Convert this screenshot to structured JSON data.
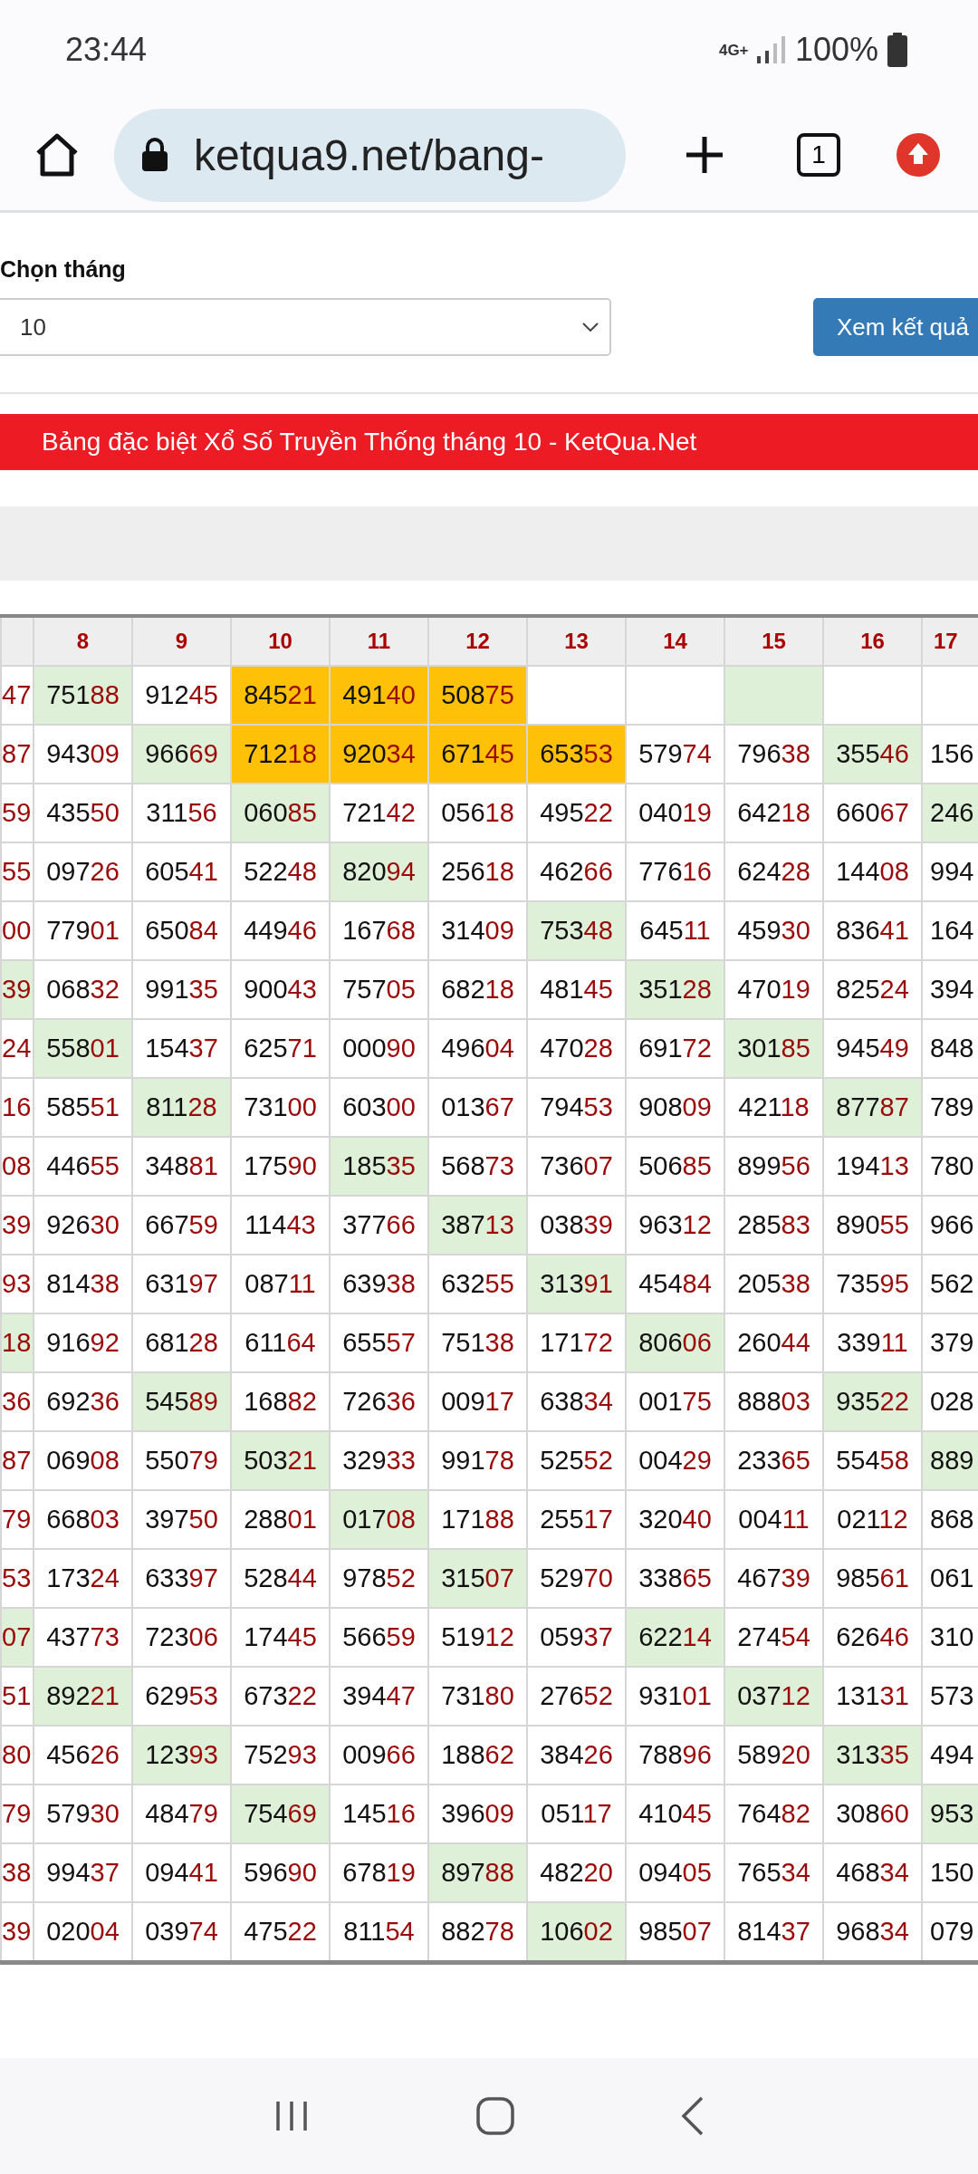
{
  "status_bar": {
    "time": "23:44",
    "network": "4G+",
    "battery": "100%"
  },
  "browser": {
    "url": "ketqua9.net/bang-",
    "tab_count": "1"
  },
  "form": {
    "label": "Chọn tháng",
    "month_select": {
      "value": "10"
    },
    "submit_button": "Xem kết quả"
  },
  "banner": "Bảng đặc biệt Xổ Số Truyền Thống tháng 10 - KetQua.Net",
  "table": {
    "columns": [
      "",
      "8",
      "9",
      "10",
      "11",
      "12",
      "13",
      "14",
      "15",
      "16",
      "17"
    ],
    "rows": [
      {
        "cells": [
          {
            "tail": "47",
            "color": "#ffffff"
          },
          {
            "head": "751",
            "tail": "88",
            "color": "#dff0d8"
          },
          {
            "head": "912",
            "tail": "45",
            "color": "#ffffff"
          },
          {
            "head": "845",
            "tail": "21",
            "color": "#ffc107"
          },
          {
            "head": "491",
            "tail": "40",
            "color": "#ffc107"
          },
          {
            "head": "508",
            "tail": "75",
            "color": "#ffc107"
          },
          {
            "color": "#ffffff"
          },
          {
            "color": "#ffffff"
          },
          {
            "color": "#dff0d8"
          },
          {
            "color": "#ffffff"
          },
          {
            "color": "#ffffff"
          }
        ]
      },
      {
        "cells": [
          {
            "tail": "87",
            "color": "#ffffff"
          },
          {
            "head": "943",
            "tail": "09",
            "color": "#ffffff"
          },
          {
            "head": "966",
            "tail": "69",
            "color": "#dff0d8"
          },
          {
            "head": "712",
            "tail": "18",
            "color": "#ffc107"
          },
          {
            "head": "920",
            "tail": "34",
            "color": "#ffc107"
          },
          {
            "head": "671",
            "tail": "45",
            "color": "#ffc107"
          },
          {
            "head": "653",
            "tail": "53",
            "color": "#ffc107"
          },
          {
            "head": "579",
            "tail": "74",
            "color": "#ffffff"
          },
          {
            "head": "796",
            "tail": "38",
            "color": "#ffffff"
          },
          {
            "head": "355",
            "tail": "46",
            "color": "#dff0d8"
          },
          {
            "head": "156",
            "color": "#ffffff"
          }
        ]
      },
      {
        "cells": [
          {
            "tail": "59",
            "color": "#ffffff"
          },
          {
            "head": "435",
            "tail": "50",
            "color": "#ffffff"
          },
          {
            "head": "311",
            "tail": "56",
            "color": "#ffffff"
          },
          {
            "head": "060",
            "tail": "85",
            "color": "#dff0d8"
          },
          {
            "head": "721",
            "tail": "42",
            "color": "#ffffff"
          },
          {
            "head": "056",
            "tail": "18",
            "color": "#ffffff"
          },
          {
            "head": "495",
            "tail": "22",
            "color": "#ffffff"
          },
          {
            "head": "040",
            "tail": "19",
            "color": "#ffffff"
          },
          {
            "head": "642",
            "tail": "18",
            "color": "#ffffff"
          },
          {
            "head": "660",
            "tail": "67",
            "color": "#ffffff"
          },
          {
            "head": "246",
            "color": "#dff0d8"
          }
        ]
      },
      {
        "cells": [
          {
            "tail": "55",
            "color": "#ffffff"
          },
          {
            "head": "097",
            "tail": "26",
            "color": "#ffffff"
          },
          {
            "head": "605",
            "tail": "41",
            "color": "#ffffff"
          },
          {
            "head": "522",
            "tail": "48",
            "color": "#ffffff"
          },
          {
            "head": "820",
            "tail": "94",
            "color": "#dff0d8"
          },
          {
            "head": "256",
            "tail": "18",
            "color": "#ffffff"
          },
          {
            "head": "462",
            "tail": "66",
            "color": "#ffffff"
          },
          {
            "head": "776",
            "tail": "16",
            "color": "#ffffff"
          },
          {
            "head": "624",
            "tail": "28",
            "color": "#ffffff"
          },
          {
            "head": "144",
            "tail": "08",
            "color": "#ffffff"
          },
          {
            "head": "994",
            "color": "#ffffff"
          }
        ]
      },
      {
        "cells": [
          {
            "tail": "00",
            "color": "#ffffff"
          },
          {
            "head": "779",
            "tail": "01",
            "color": "#ffffff"
          },
          {
            "head": "650",
            "tail": "84",
            "color": "#ffffff"
          },
          {
            "head": "449",
            "tail": "46",
            "color": "#ffffff"
          },
          {
            "head": "167",
            "tail": "68",
            "color": "#ffffff"
          },
          {
            "head": "314",
            "tail": "09",
            "color": "#ffffff"
          },
          {
            "head": "753",
            "tail": "48",
            "color": "#dff0d8"
          },
          {
            "head": "645",
            "tail": "11",
            "color": "#ffffff"
          },
          {
            "head": "459",
            "tail": "30",
            "color": "#ffffff"
          },
          {
            "head": "836",
            "tail": "41",
            "color": "#ffffff"
          },
          {
            "head": "164",
            "color": "#ffffff"
          }
        ]
      },
      {
        "cells": [
          {
            "tail": "39",
            "color": "#dff0d8"
          },
          {
            "head": "068",
            "tail": "32",
            "color": "#ffffff"
          },
          {
            "head": "991",
            "tail": "35",
            "color": "#ffffff"
          },
          {
            "head": "900",
            "tail": "43",
            "color": "#ffffff"
          },
          {
            "head": "757",
            "tail": "05",
            "color": "#ffffff"
          },
          {
            "head": "682",
            "tail": "18",
            "color": "#ffffff"
          },
          {
            "head": "481",
            "tail": "45",
            "color": "#ffffff"
          },
          {
            "head": "351",
            "tail": "28",
            "color": "#dff0d8"
          },
          {
            "head": "470",
            "tail": "19",
            "color": "#ffffff"
          },
          {
            "head": "825",
            "tail": "24",
            "color": "#ffffff"
          },
          {
            "head": "394",
            "color": "#ffffff"
          }
        ]
      },
      {
        "cells": [
          {
            "tail": "24",
            "color": "#ffffff"
          },
          {
            "head": "558",
            "tail": "01",
            "color": "#dff0d8"
          },
          {
            "head": "154",
            "tail": "37",
            "color": "#ffffff"
          },
          {
            "head": "625",
            "tail": "71",
            "color": "#ffffff"
          },
          {
            "head": "000",
            "tail": "90",
            "color": "#ffffff"
          },
          {
            "head": "496",
            "tail": "04",
            "color": "#ffffff"
          },
          {
            "head": "470",
            "tail": "28",
            "color": "#ffffff"
          },
          {
            "head": "691",
            "tail": "72",
            "color": "#ffffff"
          },
          {
            "head": "301",
            "tail": "85",
            "color": "#dff0d8"
          },
          {
            "head": "945",
            "tail": "49",
            "color": "#ffffff"
          },
          {
            "head": "848",
            "color": "#ffffff"
          }
        ]
      },
      {
        "cells": [
          {
            "tail": "16",
            "color": "#ffffff"
          },
          {
            "head": "585",
            "tail": "51",
            "color": "#ffffff"
          },
          {
            "head": "811",
            "tail": "28",
            "color": "#dff0d8"
          },
          {
            "head": "731",
            "tail": "00",
            "color": "#ffffff"
          },
          {
            "head": "603",
            "tail": "00",
            "color": "#ffffff"
          },
          {
            "head": "013",
            "tail": "67",
            "color": "#ffffff"
          },
          {
            "head": "794",
            "tail": "53",
            "color": "#ffffff"
          },
          {
            "head": "908",
            "tail": "09",
            "color": "#ffffff"
          },
          {
            "head": "421",
            "tail": "18",
            "color": "#ffffff"
          },
          {
            "head": "877",
            "tail": "87",
            "color": "#dff0d8"
          },
          {
            "head": "789",
            "color": "#ffffff"
          }
        ]
      },
      {
        "cells": [
          {
            "tail": "08",
            "color": "#ffffff"
          },
          {
            "head": "446",
            "tail": "55",
            "color": "#ffffff"
          },
          {
            "head": "348",
            "tail": "81",
            "color": "#ffffff"
          },
          {
            "head": "175",
            "tail": "90",
            "color": "#ffffff"
          },
          {
            "head": "185",
            "tail": "35",
            "color": "#dff0d8"
          },
          {
            "head": "568",
            "tail": "73",
            "color": "#ffffff"
          },
          {
            "head": "736",
            "tail": "07",
            "color": "#ffffff"
          },
          {
            "head": "506",
            "tail": "85",
            "color": "#ffffff"
          },
          {
            "head": "899",
            "tail": "56",
            "color": "#ffffff"
          },
          {
            "head": "194",
            "tail": "13",
            "color": "#ffffff"
          },
          {
            "head": "780",
            "color": "#ffffff"
          }
        ]
      },
      {
        "cells": [
          {
            "tail": "39",
            "color": "#ffffff"
          },
          {
            "head": "926",
            "tail": "30",
            "color": "#ffffff"
          },
          {
            "head": "667",
            "tail": "59",
            "color": "#ffffff"
          },
          {
            "head": "114",
            "tail": "43",
            "color": "#ffffff"
          },
          {
            "head": "377",
            "tail": "66",
            "color": "#ffffff"
          },
          {
            "head": "387",
            "tail": "13",
            "color": "#dff0d8"
          },
          {
            "head": "038",
            "tail": "39",
            "color": "#ffffff"
          },
          {
            "head": "963",
            "tail": "12",
            "color": "#ffffff"
          },
          {
            "head": "285",
            "tail": "83",
            "color": "#ffffff"
          },
          {
            "head": "890",
            "tail": "55",
            "color": "#ffffff"
          },
          {
            "head": "966",
            "color": "#ffffff"
          }
        ]
      },
      {
        "cells": [
          {
            "tail": "93",
            "color": "#ffffff"
          },
          {
            "head": "814",
            "tail": "38",
            "color": "#ffffff"
          },
          {
            "head": "631",
            "tail": "97",
            "color": "#ffffff"
          },
          {
            "head": "087",
            "tail": "11",
            "color": "#ffffff"
          },
          {
            "head": "639",
            "tail": "38",
            "color": "#ffffff"
          },
          {
            "head": "632",
            "tail": "55",
            "color": "#ffffff"
          },
          {
            "head": "313",
            "tail": "91",
            "color": "#dff0d8"
          },
          {
            "head": "454",
            "tail": "84",
            "color": "#ffffff"
          },
          {
            "head": "205",
            "tail": "38",
            "color": "#ffffff"
          },
          {
            "head": "735",
            "tail": "95",
            "color": "#ffffff"
          },
          {
            "head": "562",
            "color": "#ffffff"
          }
        ]
      },
      {
        "cells": [
          {
            "tail": "18",
            "color": "#dff0d8"
          },
          {
            "head": "916",
            "tail": "92",
            "color": "#ffffff"
          },
          {
            "head": "681",
            "tail": "28",
            "color": "#ffffff"
          },
          {
            "head": "611",
            "tail": "64",
            "color": "#ffffff"
          },
          {
            "head": "655",
            "tail": "57",
            "color": "#ffffff"
          },
          {
            "head": "751",
            "tail": "38",
            "color": "#ffffff"
          },
          {
            "head": "171",
            "tail": "72",
            "color": "#ffffff"
          },
          {
            "head": "806",
            "tail": "06",
            "color": "#dff0d8"
          },
          {
            "head": "260",
            "tail": "44",
            "color": "#ffffff"
          },
          {
            "head": "339",
            "tail": "11",
            "color": "#ffffff"
          },
          {
            "head": "379",
            "color": "#ffffff"
          }
        ]
      },
      {
        "cells": [
          {
            "tail": "36",
            "color": "#ffffff"
          },
          {
            "head": "692",
            "tail": "36",
            "color": "#ffffff"
          },
          {
            "head": "545",
            "tail": "89",
            "color": "#dff0d8"
          },
          {
            "head": "168",
            "tail": "82",
            "color": "#ffffff"
          },
          {
            "head": "726",
            "tail": "36",
            "color": "#ffffff"
          },
          {
            "head": "009",
            "tail": "17",
            "color": "#ffffff"
          },
          {
            "head": "638",
            "tail": "34",
            "color": "#ffffff"
          },
          {
            "head": "001",
            "tail": "75",
            "color": "#ffffff"
          },
          {
            "head": "888",
            "tail": "03",
            "color": "#ffffff"
          },
          {
            "head": "935",
            "tail": "22",
            "color": "#dff0d8"
          },
          {
            "head": "028",
            "color": "#ffffff"
          }
        ]
      },
      {
        "cells": [
          {
            "tail": "87",
            "color": "#ffffff"
          },
          {
            "head": "069",
            "tail": "08",
            "color": "#ffffff"
          },
          {
            "head": "550",
            "tail": "79",
            "color": "#ffffff"
          },
          {
            "head": "503",
            "tail": "21",
            "color": "#dff0d8"
          },
          {
            "head": "329",
            "tail": "33",
            "color": "#ffffff"
          },
          {
            "head": "991",
            "tail": "78",
            "color": "#ffffff"
          },
          {
            "head": "525",
            "tail": "52",
            "color": "#ffffff"
          },
          {
            "head": "004",
            "tail": "29",
            "color": "#ffffff"
          },
          {
            "head": "233",
            "tail": "65",
            "color": "#ffffff"
          },
          {
            "head": "554",
            "tail": "58",
            "color": "#ffffff"
          },
          {
            "head": "889",
            "color": "#dff0d8"
          }
        ]
      },
      {
        "cells": [
          {
            "tail": "79",
            "color": "#ffffff"
          },
          {
            "head": "668",
            "tail": "03",
            "color": "#ffffff"
          },
          {
            "head": "397",
            "tail": "50",
            "color": "#ffffff"
          },
          {
            "head": "288",
            "tail": "01",
            "color": "#ffffff"
          },
          {
            "head": "017",
            "tail": "08",
            "color": "#dff0d8"
          },
          {
            "head": "171",
            "tail": "88",
            "color": "#ffffff"
          },
          {
            "head": "255",
            "tail": "17",
            "color": "#ffffff"
          },
          {
            "head": "320",
            "tail": "40",
            "color": "#ffffff"
          },
          {
            "head": "004",
            "tail": "11",
            "color": "#ffffff"
          },
          {
            "head": "021",
            "tail": "12",
            "color": "#ffffff"
          },
          {
            "head": "868",
            "color": "#ffffff"
          }
        ]
      },
      {
        "cells": [
          {
            "tail": "53",
            "color": "#ffffff"
          },
          {
            "head": "173",
            "tail": "24",
            "color": "#ffffff"
          },
          {
            "head": "633",
            "tail": "97",
            "color": "#ffffff"
          },
          {
            "head": "528",
            "tail": "44",
            "color": "#ffffff"
          },
          {
            "head": "978",
            "tail": "52",
            "color": "#ffffff"
          },
          {
            "head": "315",
            "tail": "07",
            "color": "#dff0d8"
          },
          {
            "head": "529",
            "tail": "70",
            "color": "#ffffff"
          },
          {
            "head": "338",
            "tail": "65",
            "color": "#ffffff"
          },
          {
            "head": "467",
            "tail": "39",
            "color": "#ffffff"
          },
          {
            "head": "985",
            "tail": "61",
            "color": "#ffffff"
          },
          {
            "head": "061",
            "color": "#ffffff"
          }
        ]
      },
      {
        "cells": [
          {
            "tail": "07",
            "color": "#dff0d8"
          },
          {
            "head": "437",
            "tail": "73",
            "color": "#ffffff"
          },
          {
            "head": "723",
            "tail": "06",
            "color": "#ffffff"
          },
          {
            "head": "174",
            "tail": "45",
            "color": "#ffffff"
          },
          {
            "head": "566",
            "tail": "59",
            "color": "#ffffff"
          },
          {
            "head": "519",
            "tail": "12",
            "color": "#ffffff"
          },
          {
            "head": "059",
            "tail": "37",
            "color": "#ffffff"
          },
          {
            "head": "622",
            "tail": "14",
            "color": "#dff0d8"
          },
          {
            "head": "274",
            "tail": "54",
            "color": "#ffffff"
          },
          {
            "head": "626",
            "tail": "46",
            "color": "#ffffff"
          },
          {
            "head": "310",
            "color": "#ffffff"
          }
        ]
      },
      {
        "cells": [
          {
            "tail": "51",
            "color": "#ffffff"
          },
          {
            "head": "892",
            "tail": "21",
            "color": "#dff0d8"
          },
          {
            "head": "629",
            "tail": "53",
            "color": "#ffffff"
          },
          {
            "head": "673",
            "tail": "22",
            "color": "#ffffff"
          },
          {
            "head": "394",
            "tail": "47",
            "color": "#ffffff"
          },
          {
            "head": "731",
            "tail": "80",
            "color": "#ffffff"
          },
          {
            "head": "276",
            "tail": "52",
            "color": "#ffffff"
          },
          {
            "head": "931",
            "tail": "01",
            "color": "#ffffff"
          },
          {
            "head": "037",
            "tail": "12",
            "color": "#dff0d8"
          },
          {
            "head": "131",
            "tail": "31",
            "color": "#ffffff"
          },
          {
            "head": "573",
            "color": "#ffffff"
          }
        ]
      },
      {
        "cells": [
          {
            "tail": "80",
            "color": "#ffffff"
          },
          {
            "head": "456",
            "tail": "26",
            "color": "#ffffff"
          },
          {
            "head": "123",
            "tail": "93",
            "color": "#dff0d8"
          },
          {
            "head": "752",
            "tail": "93",
            "color": "#ffffff"
          },
          {
            "head": "009",
            "tail": "66",
            "color": "#ffffff"
          },
          {
            "head": "188",
            "tail": "62",
            "color": "#ffffff"
          },
          {
            "head": "384",
            "tail": "26",
            "color": "#ffffff"
          },
          {
            "head": "788",
            "tail": "96",
            "color": "#ffffff"
          },
          {
            "head": "589",
            "tail": "20",
            "color": "#ffffff"
          },
          {
            "head": "313",
            "tail": "35",
            "color": "#dff0d8"
          },
          {
            "head": "494",
            "color": "#ffffff"
          }
        ]
      },
      {
        "cells": [
          {
            "tail": "79",
            "color": "#ffffff"
          },
          {
            "head": "579",
            "tail": "30",
            "color": "#ffffff"
          },
          {
            "head": "484",
            "tail": "79",
            "color": "#ffffff"
          },
          {
            "head": "754",
            "tail": "69",
            "color": "#dff0d8"
          },
          {
            "head": "145",
            "tail": "16",
            "color": "#ffffff"
          },
          {
            "head": "396",
            "tail": "09",
            "color": "#ffffff"
          },
          {
            "head": "051",
            "tail": "17",
            "color": "#ffffff"
          },
          {
            "head": "410",
            "tail": "45",
            "color": "#ffffff"
          },
          {
            "head": "764",
            "tail": "82",
            "color": "#ffffff"
          },
          {
            "head": "308",
            "tail": "60",
            "color": "#ffffff"
          },
          {
            "head": "953",
            "color": "#dff0d8"
          }
        ]
      },
      {
        "cells": [
          {
            "tail": "38",
            "color": "#ffffff"
          },
          {
            "head": "994",
            "tail": "37",
            "color": "#ffffff"
          },
          {
            "head": "094",
            "tail": "41",
            "color": "#ffffff"
          },
          {
            "head": "596",
            "tail": "90",
            "color": "#ffffff"
          },
          {
            "head": "678",
            "tail": "19",
            "color": "#ffffff"
          },
          {
            "head": "897",
            "tail": "88",
            "color": "#dff0d8"
          },
          {
            "head": "482",
            "tail": "20",
            "color": "#ffffff"
          },
          {
            "head": "094",
            "tail": "05",
            "color": "#ffffff"
          },
          {
            "head": "765",
            "tail": "34",
            "color": "#ffffff"
          },
          {
            "head": "468",
            "tail": "34",
            "color": "#ffffff"
          },
          {
            "head": "150",
            "color": "#ffffff"
          }
        ]
      },
      {
        "cells": [
          {
            "tail": "39",
            "color": "#ffffff"
          },
          {
            "head": "020",
            "tail": "04",
            "color": "#ffffff"
          },
          {
            "head": "039",
            "tail": "74",
            "color": "#ffffff"
          },
          {
            "head": "475",
            "tail": "22",
            "color": "#ffffff"
          },
          {
            "head": "811",
            "tail": "54",
            "color": "#ffffff"
          },
          {
            "head": "882",
            "tail": "78",
            "color": "#ffffff"
          },
          {
            "head": "106",
            "tail": "02",
            "color": "#dff0d8"
          },
          {
            "head": "985",
            "tail": "07",
            "color": "#ffffff"
          },
          {
            "head": "814",
            "tail": "37",
            "color": "#ffffff"
          },
          {
            "head": "968",
            "tail": "34",
            "color": "#ffffff"
          },
          {
            "head": "079",
            "color": "#ffffff"
          }
        ]
      }
    ]
  }
}
